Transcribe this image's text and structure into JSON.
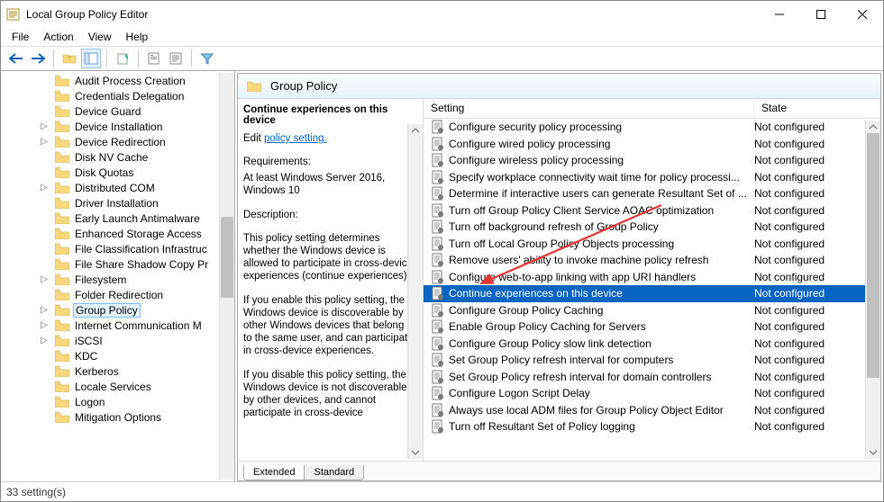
{
  "title": "Local Group Policy Editor",
  "menu": [
    "File",
    "Action",
    "View",
    "Help"
  ],
  "statusbar": "33 setting(s)",
  "right": {
    "header": "Group Policy",
    "col_setting": "Setting",
    "col_state": "State",
    "tabs": [
      "Extended",
      "Standard"
    ]
  },
  "ext": {
    "title": "Continue experiences on this device",
    "editlabel": "Edit",
    "link": "policy setting.",
    "req_h": "Requirements:",
    "req_b": "At least Windows Server 2016, Windows 10",
    "desc_h": "Description:",
    "desc_1": "This policy setting determines whether the Windows device is allowed to participate in cross-device experiences (continue experiences).",
    "desc_2": "If you enable this policy setting, the Windows device is discoverable by other Windows devices that belong to the same user, and can participate in cross-device experiences.",
    "desc_3": "If you disable this policy setting, the Windows device is not discoverable by other devices, and cannot participate in cross-device"
  },
  "tree": [
    {
      "label": "Audit Process Creation"
    },
    {
      "label": "Credentials Delegation"
    },
    {
      "label": "Device Guard"
    },
    {
      "label": "Device Installation",
      "exp": ">"
    },
    {
      "label": "Device Redirection",
      "exp": ">"
    },
    {
      "label": "Disk NV Cache"
    },
    {
      "label": "Disk Quotas"
    },
    {
      "label": "Distributed COM",
      "exp": ">"
    },
    {
      "label": "Driver Installation"
    },
    {
      "label": "Early Launch Antimalware"
    },
    {
      "label": "Enhanced Storage Access"
    },
    {
      "label": "File Classification Infrastruc"
    },
    {
      "label": "File Share Shadow Copy Pr"
    },
    {
      "label": "Filesystem",
      "exp": ">"
    },
    {
      "label": "Folder Redirection"
    },
    {
      "label": "Group Policy",
      "exp": ">",
      "sel": true
    },
    {
      "label": "Internet Communication M",
      "exp": ">"
    },
    {
      "label": "iSCSI",
      "exp": ">"
    },
    {
      "label": "KDC"
    },
    {
      "label": "Kerberos"
    },
    {
      "label": "Locale Services"
    },
    {
      "label": "Logon"
    },
    {
      "label": "Mitigation Options"
    }
  ],
  "policies": [
    {
      "name": "Configure security policy processing",
      "state": "Not configured"
    },
    {
      "name": "Configure wired policy processing",
      "state": "Not configured"
    },
    {
      "name": "Configure wireless policy processing",
      "state": "Not configured"
    },
    {
      "name": "Specify workplace connectivity wait time for policy processi...",
      "state": "Not configured"
    },
    {
      "name": "Determine if interactive users can generate Resultant Set of ...",
      "state": "Not configured"
    },
    {
      "name": "Turn off Group Policy Client Service AOAC optimization",
      "state": "Not configured"
    },
    {
      "name": "Turn off background refresh of Group Policy",
      "state": "Not configured"
    },
    {
      "name": "Turn off Local Group Policy Objects processing",
      "state": "Not configured"
    },
    {
      "name": "Remove users' ability to invoke machine policy refresh",
      "state": "Not configured"
    },
    {
      "name": "Configure web-to-app linking with app URI handlers",
      "state": "Not configured"
    },
    {
      "name": "Continue experiences on this device",
      "state": "Not configured",
      "sel": true
    },
    {
      "name": "Configure Group Policy Caching",
      "state": "Not configured"
    },
    {
      "name": "Enable Group Policy Caching for Servers",
      "state": "Not configured"
    },
    {
      "name": "Configure Group Policy slow link detection",
      "state": "Not configured"
    },
    {
      "name": "Set Group Policy refresh interval for computers",
      "state": "Not configured"
    },
    {
      "name": "Set Group Policy refresh interval for domain controllers",
      "state": "Not configured"
    },
    {
      "name": "Configure Logon Script Delay",
      "state": "Not configured"
    },
    {
      "name": "Always use local ADM files for Group Policy Object Editor",
      "state": "Not configured"
    },
    {
      "name": "Turn off Resultant Set of Policy logging",
      "state": "Not configured"
    }
  ]
}
